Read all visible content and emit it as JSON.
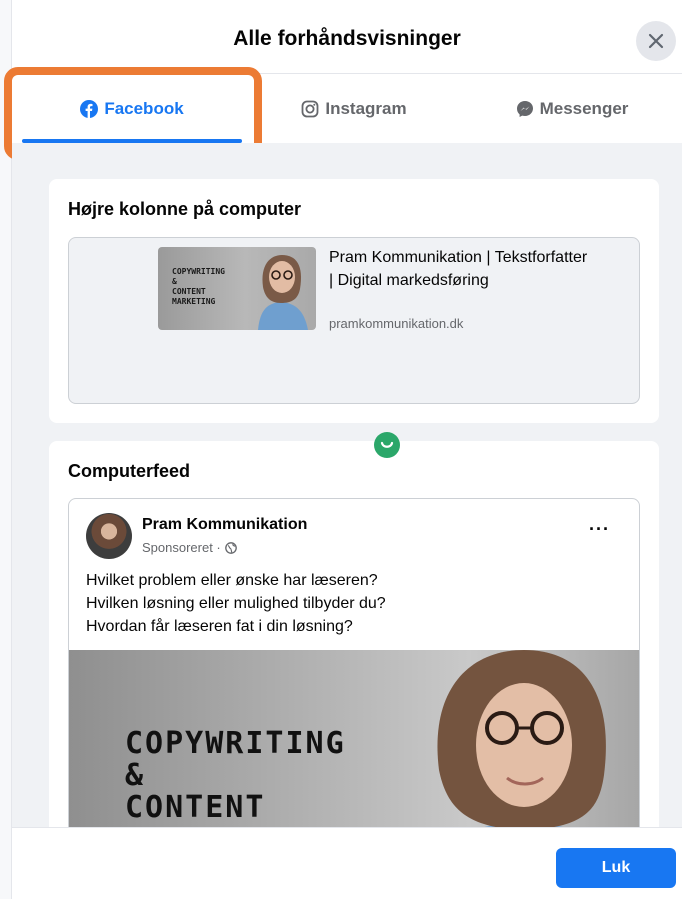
{
  "dialog": {
    "title": "Alle forhåndsvisninger",
    "close_icon": "close-icon"
  },
  "tabs": [
    {
      "label": "Facebook",
      "icon": "facebook-icon",
      "active": true
    },
    {
      "label": "Instagram",
      "icon": "instagram-icon",
      "active": false
    },
    {
      "label": "Messenger",
      "icon": "messenger-icon",
      "active": false
    }
  ],
  "right_column": {
    "title": "Højre kolonne på computer",
    "thumb_text": "COPYWRITING\n&\nCONTENT\nMARKETING",
    "link_title": "Pram Kommunikation | Tekstforfatter | Digital markedsføring",
    "domain": "pramkommunikation.dk"
  },
  "feed": {
    "title": "Computerfeed",
    "page_name": "Pram Kommunikation",
    "sponsored": "Sponsoreret ·",
    "more_label": "···",
    "text_lines": [
      "Hvilket problem eller ønske har læseren?",
      "Hvilken løsning eller mulighed tilbyder du?",
      "Hvordan får læseren fat i din løsning?"
    ],
    "image_text": "COPYWRITING\n&\nCONTENT"
  },
  "footer": {
    "close_label": "Luk"
  },
  "colors": {
    "accent": "#1877f2",
    "highlight": "#ec7b34",
    "status_green": "#2ba76a"
  }
}
